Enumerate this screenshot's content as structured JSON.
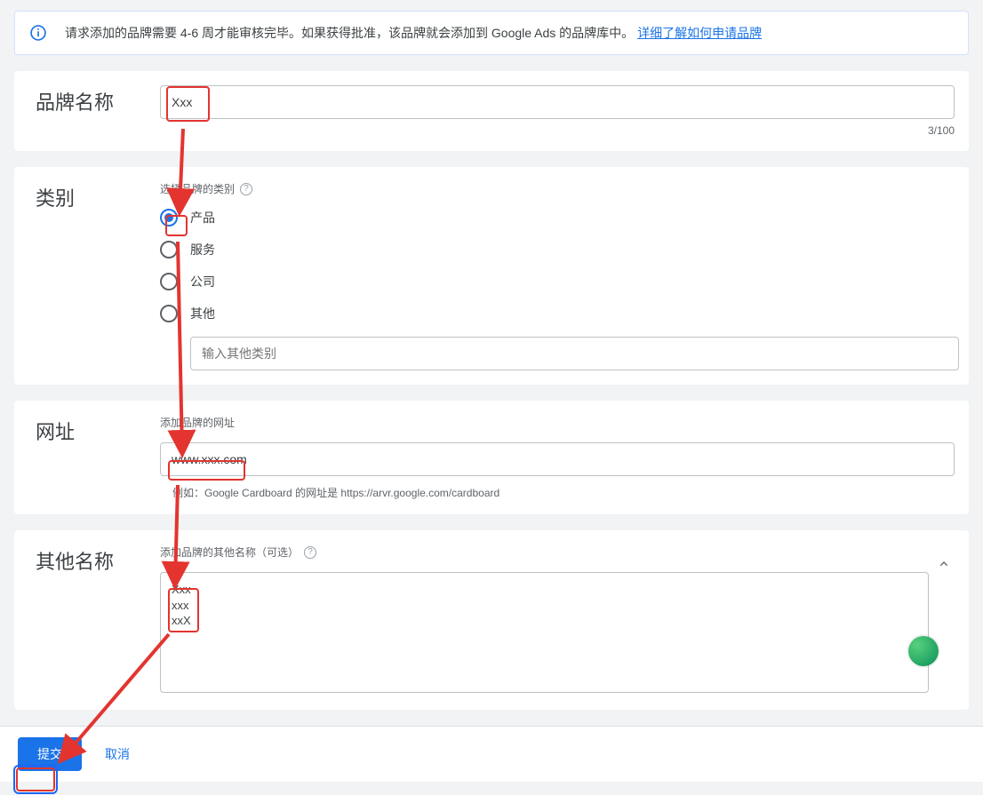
{
  "banner": {
    "text": "请求添加的品牌需要 4-6 周才能审核完毕。如果获得批准，该品牌就会添加到 Google Ads 的品牌库中。",
    "link": "详细了解如何申请品牌"
  },
  "brand_name": {
    "label": "品牌名称",
    "value": "Xxx",
    "counter": "3/100"
  },
  "category": {
    "label": "类别",
    "subtitle": "选择品牌的类别",
    "options": {
      "product": "产品",
      "service": "服务",
      "company": "公司",
      "other": "其他"
    },
    "selected": "product",
    "other_placeholder": "输入其他类别"
  },
  "url": {
    "label": "网址",
    "subtitle": "添加品牌的网址",
    "value": "www.xxx.com",
    "example": "例如：Google Cardboard 的网址是 https://arvr.google.com/cardboard"
  },
  "other_names": {
    "label": "其他名称",
    "subtitle": "添加品牌的其他名称（可选）",
    "value": "Xxx\nxxx\nxxX"
  },
  "footer": {
    "submit": "提交",
    "cancel": "取消"
  }
}
